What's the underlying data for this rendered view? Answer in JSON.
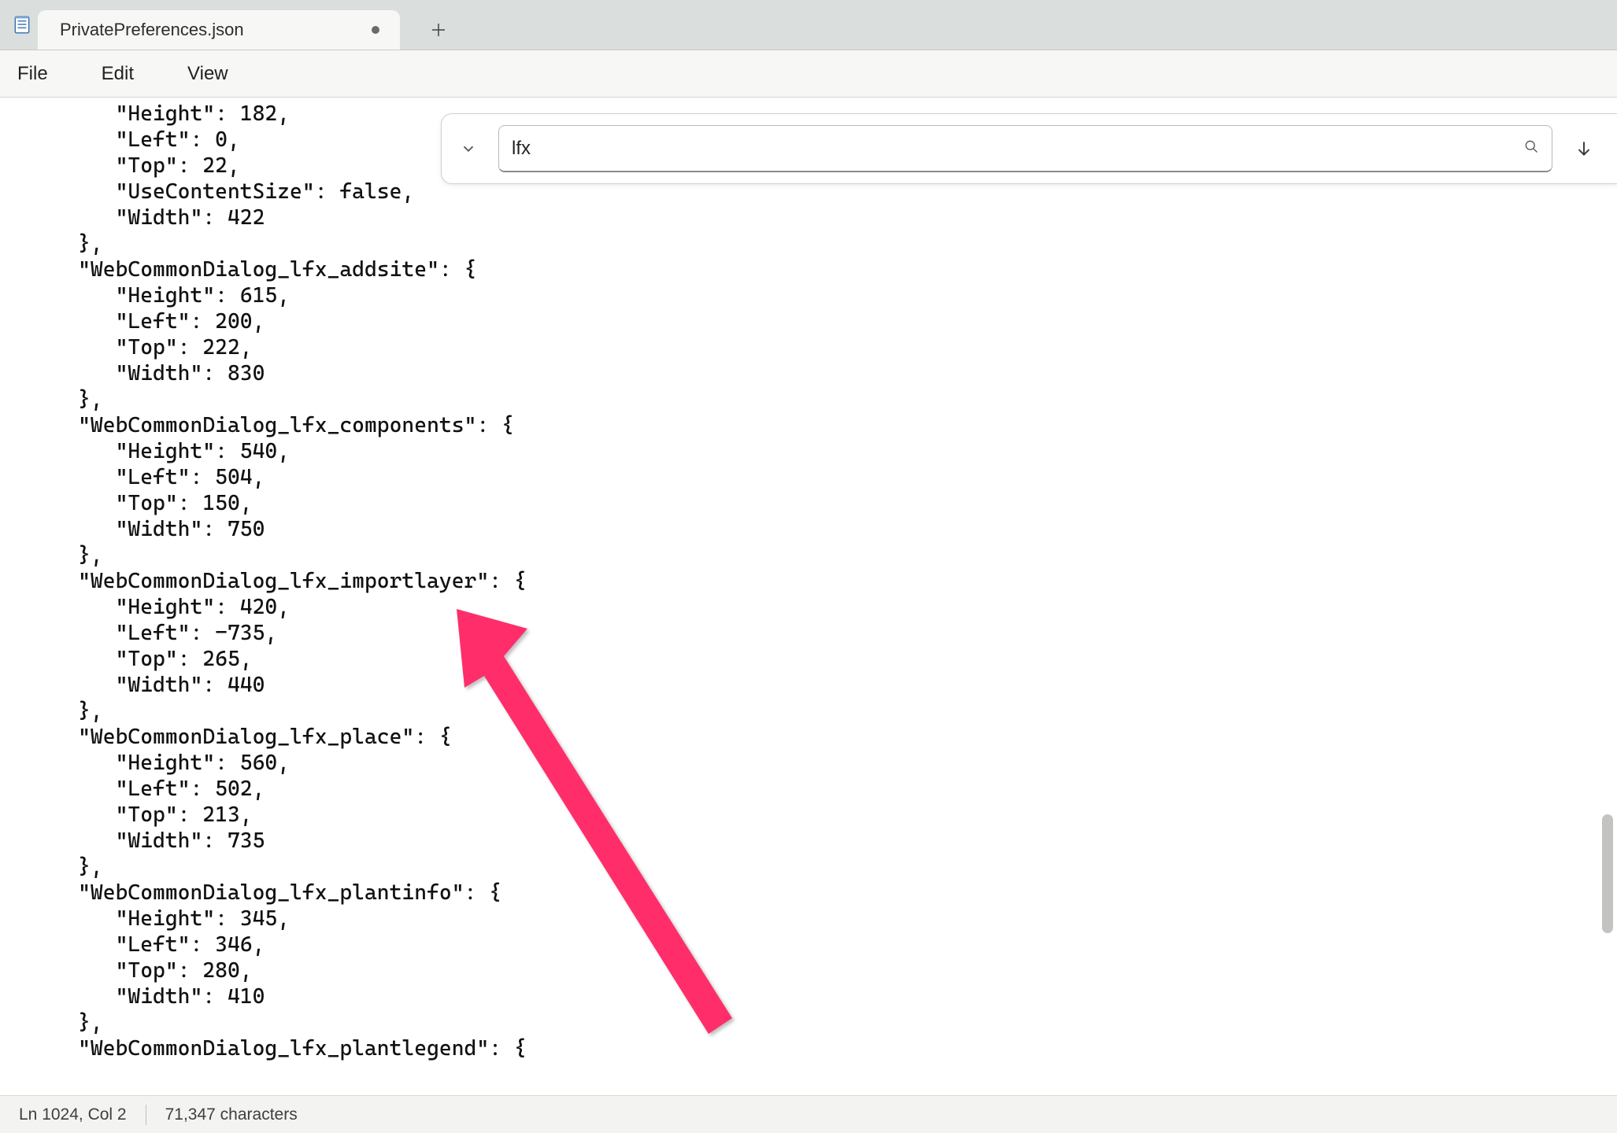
{
  "tab": {
    "title": "PrivatePreferences.json",
    "dirty": true
  },
  "menu": {
    "file": "File",
    "edit": "Edit",
    "view": "View"
  },
  "find": {
    "query": "lfx"
  },
  "editor": {
    "text": "        \"Height\": 182,\n        \"Left\": 0,\n        \"Top\": 22,\n        \"UseContentSize\": false,\n        \"Width\": 422\n     },\n     \"WebCommonDialog_lfx_addsite\": {\n        \"Height\": 615,\n        \"Left\": 200,\n        \"Top\": 222,\n        \"Width\": 830\n     },\n     \"WebCommonDialog_lfx_components\": {\n        \"Height\": 540,\n        \"Left\": 504,\n        \"Top\": 150,\n        \"Width\": 750\n     },\n     \"WebCommonDialog_lfx_importlayer\": {\n        \"Height\": 420,\n        \"Left\": -735,\n        \"Top\": 265,\n        \"Width\": 440\n     },\n     \"WebCommonDialog_lfx_place\": {\n        \"Height\": 560,\n        \"Left\": 502,\n        \"Top\": 213,\n        \"Width\": 735\n     },\n     \"WebCommonDialog_lfx_plantinfo\": {\n        \"Height\": 345,\n        \"Left\": 346,\n        \"Top\": 280,\n        \"Width\": 410\n     },\n     \"WebCommonDialog_lfx_plantlegend\": {"
  },
  "status": {
    "position": "Ln 1024, Col 2",
    "chars": "71,347 characters"
  },
  "annotation": {
    "color": "#ff2d6b"
  }
}
